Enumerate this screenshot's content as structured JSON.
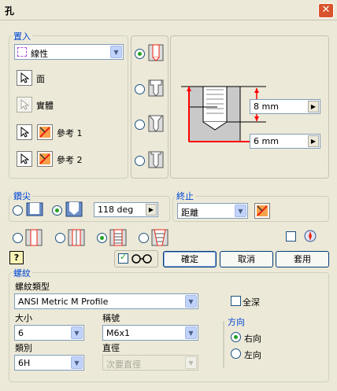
{
  "window": {
    "title": "孔",
    "close_icon": "close-icon"
  },
  "placement": {
    "legend": "置入",
    "type_value": "線性",
    "face_label": "面",
    "solid_label": "實體",
    "ref1_label": "參考 1",
    "ref2_label": "參考 2"
  },
  "preview": {
    "depth_value": "8 mm",
    "diameter_value": "6 mm"
  },
  "drill_point": {
    "legend": "鑽尖",
    "angle_value": "118 deg",
    "selected": "angled"
  },
  "termination": {
    "legend": "終止",
    "value": "距離"
  },
  "hole_types": {
    "selected": "tapped"
  },
  "buttons": {
    "ok": "確定",
    "cancel": "取消",
    "apply": "套用"
  },
  "thread": {
    "legend": "螺紋",
    "type_label": "螺紋類型",
    "type_value": "ANSI Metric M Profile",
    "full_depth_label": "全深",
    "size_label": "大小",
    "size_value": "6",
    "designation_label": "稱號",
    "designation_value": "M6x1",
    "class_label": "類別",
    "class_value": "6H",
    "diameter_label": "直徑",
    "diameter_value": "次要直徑"
  },
  "direction": {
    "legend": "方向",
    "right_label": "右向",
    "left_label": "左向",
    "selected": "right"
  },
  "colors": {
    "accent": "#0046d5",
    "dimension": "#ff0000",
    "selected_radio": "#21a121"
  }
}
